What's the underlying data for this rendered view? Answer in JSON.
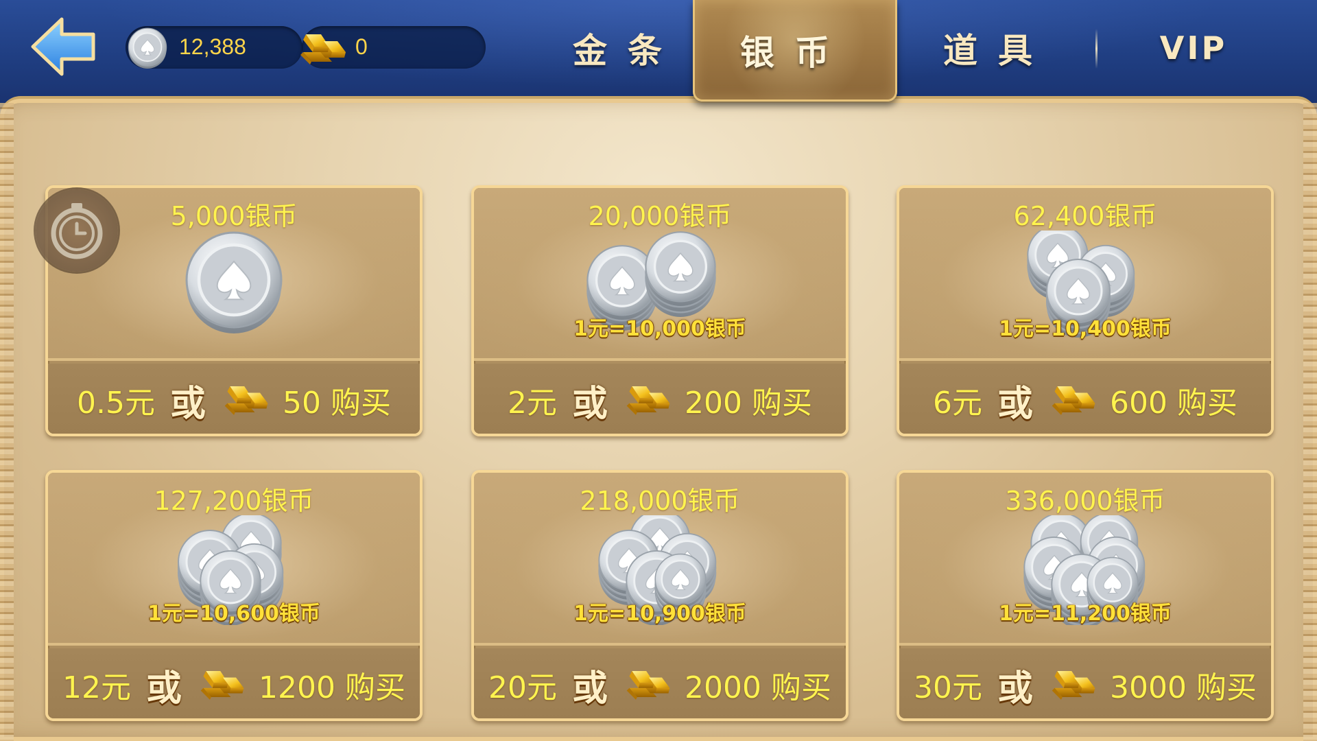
{
  "header": {
    "silver_balance": "12,388",
    "gold_balance": "0",
    "tabs": [
      {
        "label": "金条"
      },
      {
        "label": "银币"
      },
      {
        "label": "道具"
      },
      {
        "label": "VIP"
      }
    ],
    "active_tab": "银币"
  },
  "colors": {
    "header_bg": "#2a4d98",
    "panel_bg": "#e7d4b0",
    "card_border": "#f6d796",
    "amount_text": "#fff44f",
    "rate_text": "#ffe13a"
  },
  "cards": [
    {
      "amount": "5,000银币",
      "rate": "",
      "price": "0.5元",
      "or": "或",
      "gold": "50 购买",
      "coins": 1
    },
    {
      "amount": "20,000银币",
      "rate": "1元=10,000银币",
      "price": "2元",
      "or": "或",
      "gold": "200 购买",
      "coins": 2
    },
    {
      "amount": "62,400银币",
      "rate": "1元=10,400银币",
      "price": "6元",
      "or": "或",
      "gold": "600 购买",
      "coins": 3
    },
    {
      "amount": "127,200银币",
      "rate": "1元=10,600银币",
      "price": "12元",
      "or": "或",
      "gold": "1200 购买",
      "coins": 4
    },
    {
      "amount": "218,000银币",
      "rate": "1元=10,900银币",
      "price": "20元",
      "or": "或",
      "gold": "2000 购买",
      "coins": 5
    },
    {
      "amount": "336,000银币",
      "rate": "1元=11,200银币",
      "price": "30元",
      "or": "或",
      "gold": "3000 购买",
      "coins": 6
    }
  ],
  "icons": {
    "back": "back-arrow-icon",
    "silver": "silver-coin-icon",
    "gold": "gold-bar-icon",
    "timer": "timer-icon"
  }
}
